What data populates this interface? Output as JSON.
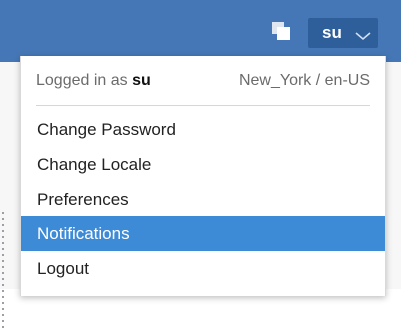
{
  "header": {
    "username_button_label": "su",
    "copy_icon": "copy-icon",
    "chevron_icon": "chevron-down-icon"
  },
  "menu": {
    "logged_in_prefix": "Logged in as ",
    "logged_in_user": "su",
    "locale_info": "New_York / en-US",
    "items": [
      {
        "label": "Change Password",
        "active": false
      },
      {
        "label": "Change Locale",
        "active": false
      },
      {
        "label": "Preferences",
        "active": false
      },
      {
        "label": "Notifications",
        "active": true
      },
      {
        "label": "Logout",
        "active": false
      }
    ]
  },
  "colors": {
    "topbar": "#4577b6",
    "user_button": "#2f5f9b",
    "highlight": "#3d8bd6"
  }
}
